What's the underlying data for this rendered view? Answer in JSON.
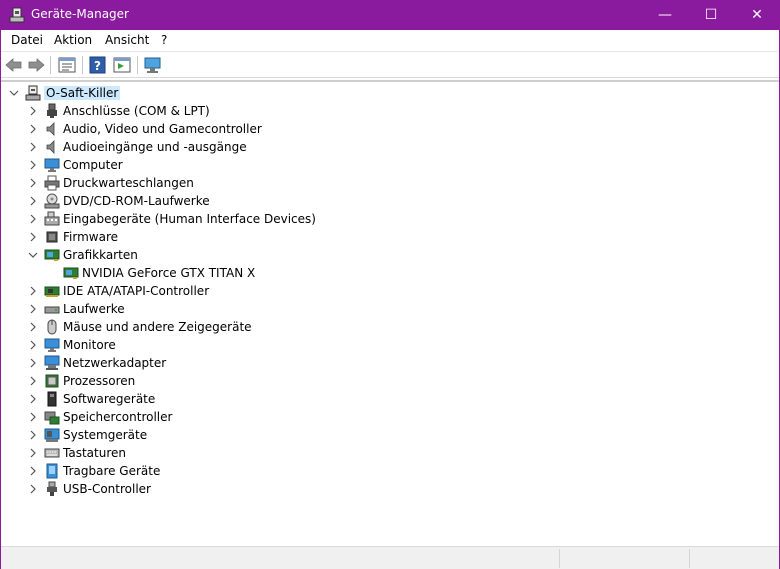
{
  "window": {
    "title": "Geräte-Manager",
    "accent_color": "#8a1a9e",
    "controls": {
      "minimize": "—",
      "maximize": "☐",
      "close": "✕"
    }
  },
  "menu": [
    "Datei",
    "Aktion",
    "Ansicht",
    "?"
  ],
  "toolbar": {
    "buttons": [
      "back-arrow-icon",
      "forward-arrow-icon",
      "properties-list-icon",
      "help-icon",
      "update-driver-icon",
      "scan-hardware-icon"
    ]
  },
  "tree": {
    "root": {
      "label": "O-Saft-Killer",
      "expanded": true,
      "selected": true
    },
    "items": [
      {
        "label": "Anschlüsse (COM & LPT)",
        "expanded": false,
        "icon": "port-icon"
      },
      {
        "label": "Audio, Video und Gamecontroller",
        "expanded": false,
        "icon": "speaker-icon"
      },
      {
        "label": "Audioeingänge und -ausgänge",
        "expanded": false,
        "icon": "speaker-icon"
      },
      {
        "label": "Computer",
        "expanded": false,
        "icon": "monitor-icon"
      },
      {
        "label": "Druckwarteschlangen",
        "expanded": false,
        "icon": "printer-icon"
      },
      {
        "label": "DVD/CD-ROM-Laufwerke",
        "expanded": false,
        "icon": "disc-drive-icon"
      },
      {
        "label": "Eingabegeräte (Human Interface Devices)",
        "expanded": false,
        "icon": "keyboard-hid-icon"
      },
      {
        "label": "Firmware",
        "expanded": false,
        "icon": "chip-icon"
      },
      {
        "label": "Grafikkarten",
        "expanded": true,
        "icon": "display-adapter-icon",
        "children": [
          {
            "label": "NVIDIA GeForce GTX TITAN X",
            "icon": "display-adapter-icon"
          }
        ]
      },
      {
        "label": "IDE ATA/ATAPI-Controller",
        "expanded": false,
        "icon": "controller-card-icon"
      },
      {
        "label": "Laufwerke",
        "expanded": false,
        "icon": "disk-drive-icon"
      },
      {
        "label": "Mäuse und andere Zeigegeräte",
        "expanded": false,
        "icon": "mouse-icon"
      },
      {
        "label": "Monitore",
        "expanded": false,
        "icon": "monitor-icon"
      },
      {
        "label": "Netzwerkadapter",
        "expanded": false,
        "icon": "network-adapter-icon"
      },
      {
        "label": "Prozessoren",
        "expanded": false,
        "icon": "processor-icon"
      },
      {
        "label": "Softwaregeräte",
        "expanded": false,
        "icon": "software-device-icon"
      },
      {
        "label": "Speichercontroller",
        "expanded": false,
        "icon": "storage-controller-icon"
      },
      {
        "label": "Systemgeräte",
        "expanded": false,
        "icon": "system-device-icon"
      },
      {
        "label": "Tastaturen",
        "expanded": false,
        "icon": "keyboard-icon"
      },
      {
        "label": "Tragbare Geräte",
        "expanded": false,
        "icon": "portable-device-icon"
      },
      {
        "label": "USB-Controller",
        "expanded": false,
        "icon": "usb-icon"
      }
    ]
  }
}
